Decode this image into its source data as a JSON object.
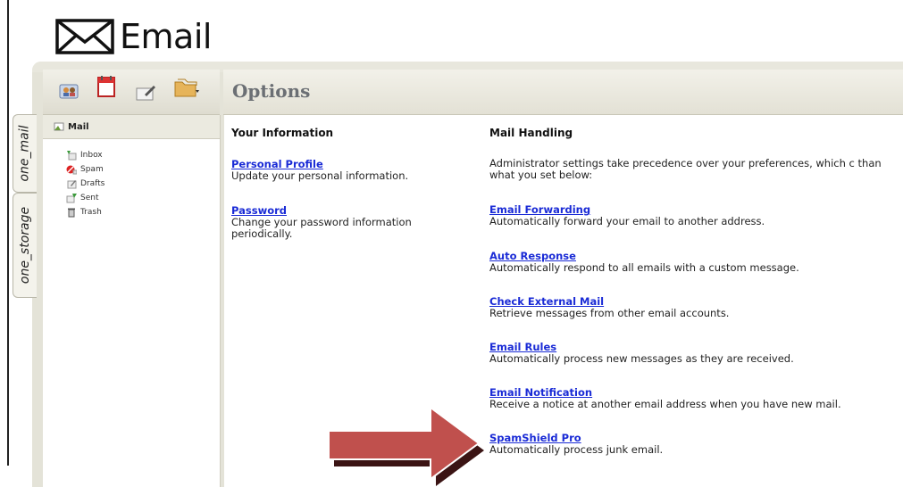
{
  "brand": {
    "title": "Email"
  },
  "toolbar": {
    "icons": [
      "contacts-icon",
      "calendar-icon",
      "compose-icon",
      "folder-menu-icon"
    ]
  },
  "header": {
    "title": "Options"
  },
  "tabs": {
    "mail": "one_mail",
    "storage": "one_storage"
  },
  "sidebar": {
    "title": "Mail",
    "folders": [
      {
        "label": "Inbox",
        "icon": "inbox-icon"
      },
      {
        "label": "Spam",
        "icon": "spam-icon"
      },
      {
        "label": "Drafts",
        "icon": "drafts-icon"
      },
      {
        "label": "Sent",
        "icon": "sent-icon"
      },
      {
        "label": "Trash",
        "icon": "trash-icon"
      }
    ]
  },
  "your_information": {
    "heading": "Your Information",
    "items": [
      {
        "link": "Personal Profile",
        "desc": "Update your personal information."
      },
      {
        "link": "Password",
        "desc": "Change your password information periodically."
      }
    ]
  },
  "mail_handling": {
    "heading": "Mail Handling",
    "intro": "Administrator settings take precedence over your preferences, which c than what you set below:",
    "items": [
      {
        "link": "Email Forwarding",
        "desc": "Automatically forward your email to another address."
      },
      {
        "link": "Auto Response",
        "desc": "Automatically respond to all emails with a custom message."
      },
      {
        "link": "Check External Mail",
        "desc": "Retrieve messages from other email accounts."
      },
      {
        "link": "Email Rules",
        "desc": "Automatically process new messages as they are received."
      },
      {
        "link": "Email Notification",
        "desc": "Receive a notice at another email address when you have new mail."
      },
      {
        "link": "SpamShield Pro",
        "desc": "Automatically process junk email."
      }
    ]
  },
  "colors": {
    "link": "#1a2bd6",
    "arrow": "#c0504d",
    "frame": "#e4e3d8"
  }
}
